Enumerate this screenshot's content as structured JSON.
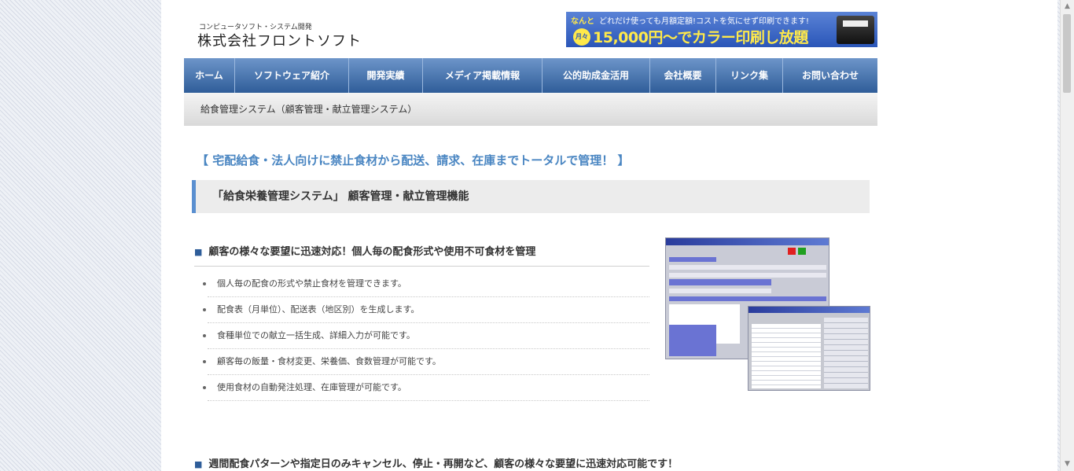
{
  "header": {
    "logo_sub": "コンピュータソフト・システム開発",
    "logo_main": "株式会社フロントソフト",
    "banner": {
      "nanto": "なんと",
      "top_text": "どれだけ使っても月額定額!コストを気にせず印刷できます!",
      "badge": "月々",
      "main": "15,000円〜でカラー印刷し放題"
    }
  },
  "nav": [
    "ホーム",
    "ソフトウェア紹介",
    "開発実績",
    "メディア掲載情報",
    "公的助成金活用",
    "会社概要",
    "リンク集",
    "お問い合わせ"
  ],
  "breadcrumb": "給食管理システム（顧客管理・献立管理システム）",
  "lead": "【 宅配給食・法人向けに禁止食材から配送、請求、在庫までトータルで管理！ 】",
  "section_title": "「給食栄養管理システム」 顧客管理・献立管理機能",
  "feature_heading": "顧客の様々な要望に迅速対応！個人毎の配食形式や使用不可食材を管理",
  "features": [
    "個人毎の配食の形式や禁止食材を管理できます。",
    "配食表（月単位）、配送表（地区別）を生成します。",
    "食種単位での献立一括生成、詳細入力が可能です。",
    "顧客毎の飯量・食材変更、栄養価、食数管理が可能です。",
    "使用食材の自動発注処理、在庫管理が可能です。"
  ],
  "next_heading": "週間配食パターンや指定日のみキャンセル、停止・再開など、顧客の様々な要望に迅速対応可能です！",
  "heading_marker": "■"
}
